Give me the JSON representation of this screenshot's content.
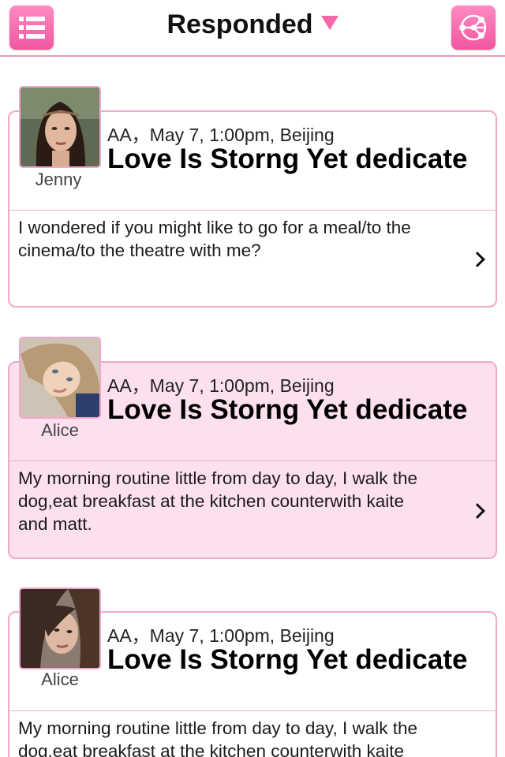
{
  "header": {
    "title": "Responded"
  },
  "icons": {
    "menu": "list-menu-icon",
    "share": "share-network-icon",
    "dropdown": "triangle-down-icon",
    "detail": "chevron-right-icon"
  },
  "colors": {
    "accent": "#f06aaa",
    "border": "#f0a8cb",
    "highlight_bg": "#fde0ee"
  },
  "posts": [
    {
      "user": "Jenny",
      "meta": "AA，May 7, 1:00pm, Beijing",
      "headline": "Love Is Storng Yet dedicate",
      "lines": [
        "I wondered if you might like to go for a meal/to the",
        "cinema/to the theatre with me?"
      ]
    },
    {
      "user": "Alice",
      "meta": "AA，May 7, 1:00pm, Beijing",
      "headline": "Love Is Storng Yet dedicate",
      "lines": [
        "My morning routine little from day to day, I walk the",
        "dog,eat breakfast at the kitchen counterwith kaite",
        "and matt."
      ]
    },
    {
      "user": "Alice",
      "meta": "AA，May 7, 1:00pm, Beijing",
      "headline": "Love Is Storng Yet dedicate",
      "lines": [
        "My morning routine little from day to day, I walk the",
        "dog,eat breakfast at the kitchen counterwith kaite"
      ]
    }
  ]
}
